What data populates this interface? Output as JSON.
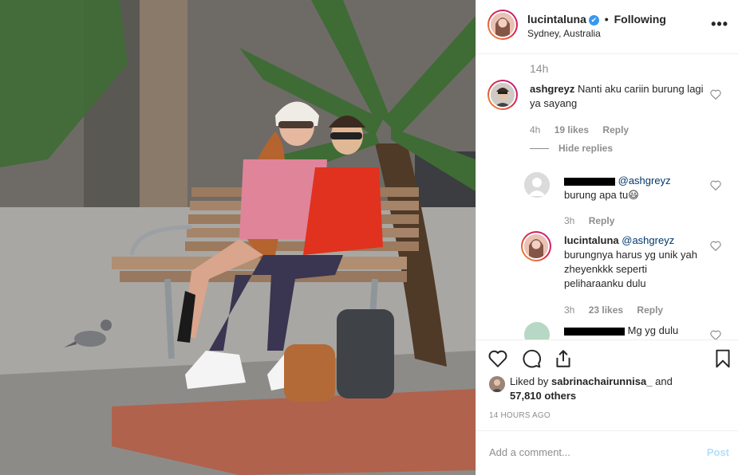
{
  "post": {
    "username": "lucintaluna",
    "verified_glyph": "✔",
    "dot": "•",
    "follow_status": "Following",
    "location": "Sydney, Australia",
    "more_icon": "more-icon"
  },
  "comments_area": {
    "top_time": "14h",
    "comments": [
      {
        "username": "ashgreyz",
        "text": "Nanti aku cariin burung lagi ya sayang",
        "time": "4h",
        "likes": "19 likes",
        "reply": "Reply",
        "hide_replies": "Hide replies"
      },
      {
        "username": "",
        "mention": "@ashgreyz",
        "text": "burung apa tu😃",
        "time": "3h",
        "reply": "Reply"
      },
      {
        "username": "lucintaluna",
        "mention": "@ashgreyz",
        "text": "burungnya harus yg unik yah zheyenkkk seperti peliharaanku dulu",
        "time": "3h",
        "likes": "23 likes",
        "reply": "Reply"
      },
      {
        "username": "",
        "text": "Mg yg dulu"
      }
    ]
  },
  "actions": {
    "like_icon": "heart-icon",
    "comment_icon": "comment-icon",
    "share_icon": "share-icon",
    "save_icon": "bookmark-icon"
  },
  "likes": {
    "prefix": "Liked by ",
    "liked_by": "sabrinachairunnisa_",
    "and": " and",
    "others": "57,810 others"
  },
  "timestamp": "14 HOURS AGO",
  "comment_box": {
    "placeholder": "Add a comment...",
    "post_label": "Post"
  },
  "colors": {
    "verified": "#3897f0",
    "secondary_text": "#8e8e8e",
    "post_disabled": "#b2dffc"
  }
}
